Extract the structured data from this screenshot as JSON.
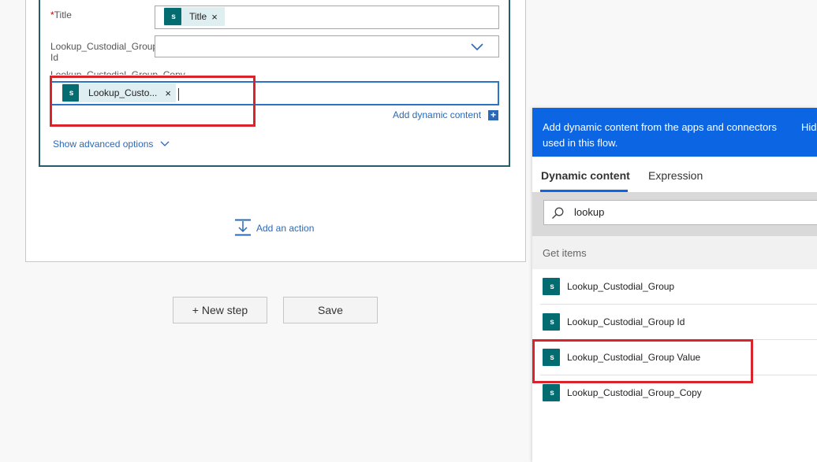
{
  "form": {
    "title_label": "Title",
    "title_required_mark": "*",
    "title_token": "Title",
    "lookup_id_label_1": "Lookup_Custodial_Group",
    "lookup_id_label_2": "Id",
    "copy_label": "Lookup_Custodial_Group_Copy",
    "copy_token": "Lookup_Custo...",
    "token_remove": "×",
    "add_dynamic_content": "Add dynamic content",
    "add_dynamic_plus": "+",
    "show_advanced": "Show advanced options",
    "dropdown_chevron": "chevron-down-icon",
    "sharepoint_icon": "sharepoint-icon",
    "sharepoint_glyph": "s"
  },
  "flow": {
    "add_action": "Add an action",
    "new_step": "+ New step",
    "save": "Save"
  },
  "panel": {
    "header_text_line1": "Add dynamic content from the apps and connectors",
    "header_text_line2": "used in this flow.",
    "hide_label": "Hid",
    "tabs": [
      {
        "label": "Dynamic content",
        "active": true
      },
      {
        "label": "Expression",
        "active": false
      }
    ],
    "search_value": "lookup",
    "section_title": "Get items",
    "items": [
      {
        "label": "Lookup_Custodial_Group"
      },
      {
        "label": "Lookup_Custodial_Group Id"
      },
      {
        "label": "Lookup_Custodial_Group Value"
      },
      {
        "label": "Lookup_Custodial_Group_Copy"
      }
    ]
  },
  "colors": {
    "accent_blue": "#0c66e4",
    "card_border": "#235d6b",
    "sharepoint_teal": "#036c70",
    "highlight_red": "#d9242c"
  }
}
